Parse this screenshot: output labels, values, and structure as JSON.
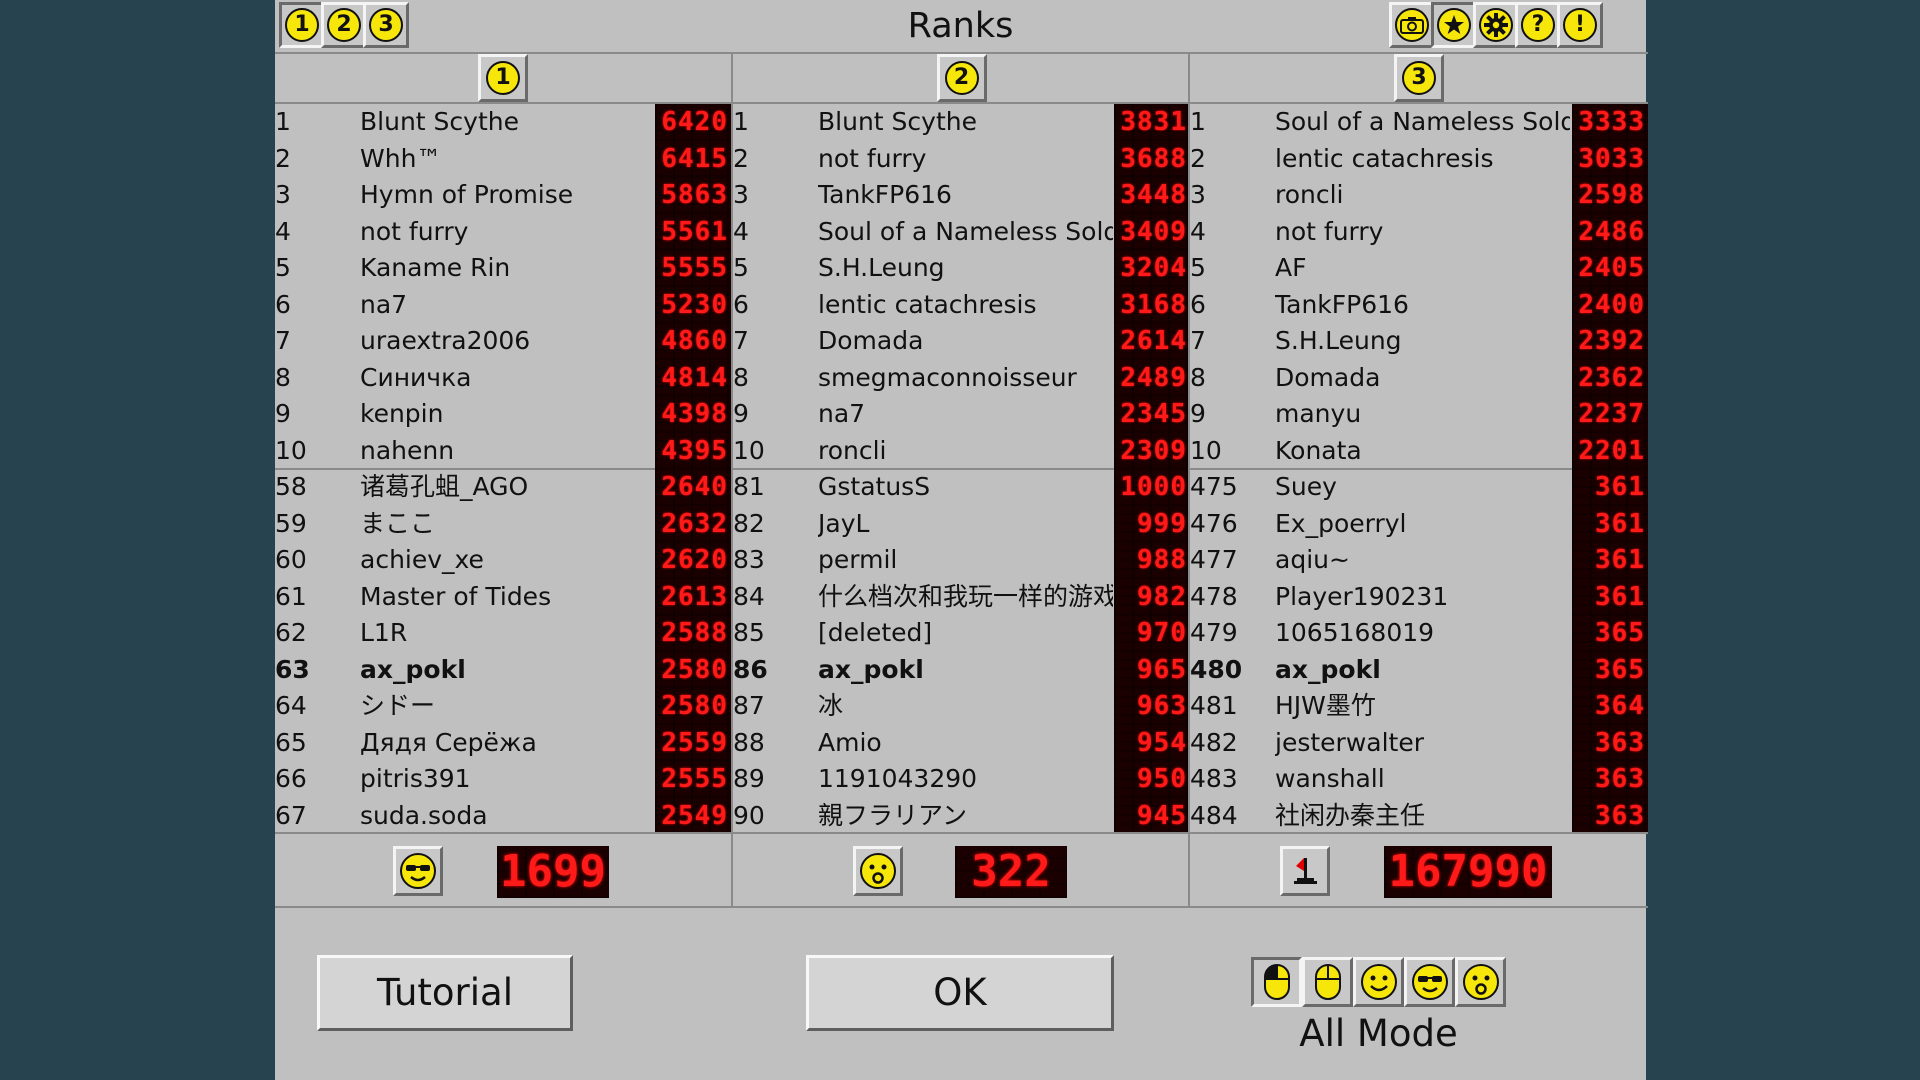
{
  "title": "Ranks",
  "colors": {
    "led_red": "#ff1a1a",
    "coin_yellow": "#f6e60a",
    "panel_gray": "#c0c0c0",
    "desktop": "#27434f"
  },
  "toolbar_left": [
    {
      "label": "1",
      "icon": "number-1-icon",
      "active": true
    },
    {
      "label": "2",
      "icon": "number-2-icon",
      "active": false
    },
    {
      "label": "3",
      "icon": "number-3-icon",
      "active": false
    }
  ],
  "toolbar_right": [
    {
      "icon": "camera-icon"
    },
    {
      "icon": "star-icon",
      "active": true
    },
    {
      "icon": "gear-icon"
    },
    {
      "icon": "help-icon",
      "label": "?"
    },
    {
      "icon": "exclamation-icon",
      "label": "!"
    }
  ],
  "columns": [
    {
      "header": "1",
      "top": [
        {
          "rank": "1",
          "name": "Blunt Scythe",
          "score": "6420"
        },
        {
          "rank": "2",
          "name": "Whh™",
          "score": "6415"
        },
        {
          "rank": "3",
          "name": "Hymn of Promise",
          "score": "5863"
        },
        {
          "rank": "4",
          "name": "not furry",
          "score": "5561"
        },
        {
          "rank": "5",
          "name": "Kaname Rin",
          "score": "5555"
        },
        {
          "rank": "6",
          "name": "na7",
          "score": "5230"
        },
        {
          "rank": "7",
          "name": "uraextra2006",
          "score": "4860"
        },
        {
          "rank": "8",
          "name": "Синичка",
          "score": "4814"
        },
        {
          "rank": "9",
          "name": "kenpin",
          "score": "4398"
        },
        {
          "rank": "10",
          "name": "nahenn",
          "score": "4395"
        }
      ],
      "near": [
        {
          "rank": "58",
          "name": "诸葛孔蛆_AGO",
          "score": "2640"
        },
        {
          "rank": "59",
          "name": "まここ",
          "score": "2632"
        },
        {
          "rank": "60",
          "name": "achiev_xe",
          "score": "2620"
        },
        {
          "rank": "61",
          "name": "Master of Tides",
          "score": "2613"
        },
        {
          "rank": "62",
          "name": "L1R",
          "score": "2588"
        },
        {
          "rank": "63",
          "name": "ax_pokl",
          "score": "2580",
          "me": true
        },
        {
          "rank": "64",
          "name": "シドー",
          "score": "2580"
        },
        {
          "rank": "65",
          "name": "Дядя Серёжа",
          "score": "2559"
        },
        {
          "rank": "66",
          "name": "pitris391",
          "score": "2555"
        },
        {
          "rank": "67",
          "name": "suda.soda",
          "score": "2549"
        }
      ],
      "footer": {
        "icon": "sunglasses-face-icon",
        "value": "1699"
      }
    },
    {
      "header": "2",
      "top": [
        {
          "rank": "1",
          "name": "Blunt Scythe",
          "score": "3831"
        },
        {
          "rank": "2",
          "name": "not furry",
          "score": "3688"
        },
        {
          "rank": "3",
          "name": "TankFP616",
          "score": "3448"
        },
        {
          "rank": "4",
          "name": "Soul of a Nameless Soldier",
          "score": "3409"
        },
        {
          "rank": "5",
          "name": "S.H.Leung",
          "score": "3204"
        },
        {
          "rank": "6",
          "name": "lentic catachresis",
          "score": "3168"
        },
        {
          "rank": "7",
          "name": "Domada",
          "score": "2614"
        },
        {
          "rank": "8",
          "name": "smegmaconnoisseur",
          "score": "2489"
        },
        {
          "rank": "9",
          "name": "na7",
          "score": "2345"
        },
        {
          "rank": "10",
          "name": "roncli",
          "score": "2309"
        }
      ],
      "near": [
        {
          "rank": "81",
          "name": "GstatusS",
          "score": "1000"
        },
        {
          "rank": "82",
          "name": "JayL",
          "score": "999"
        },
        {
          "rank": "83",
          "name": "permil",
          "score": "988"
        },
        {
          "rank": "84",
          "name": "什么档次和我玩一样的游戏",
          "score": "982"
        },
        {
          "rank": "85",
          "name": "[deleted]",
          "score": "970"
        },
        {
          "rank": "86",
          "name": "ax_pokl",
          "score": "965",
          "me": true
        },
        {
          "rank": "87",
          "name": "冰",
          "score": "963"
        },
        {
          "rank": "88",
          "name": "Amio",
          "score": "954"
        },
        {
          "rank": "89",
          "name": "1191043290",
          "score": "950"
        },
        {
          "rank": "90",
          "name": "親フラリアン",
          "score": "945"
        }
      ],
      "footer": {
        "icon": "surprised-face-icon",
        "value": "322"
      }
    },
    {
      "header": "3",
      "top": [
        {
          "rank": "1",
          "name": "Soul of a Nameless Soldier",
          "score": "3333"
        },
        {
          "rank": "2",
          "name": "lentic catachresis",
          "score": "3033"
        },
        {
          "rank": "3",
          "name": "roncli",
          "score": "2598"
        },
        {
          "rank": "4",
          "name": "not furry",
          "score": "2486"
        },
        {
          "rank": "5",
          "name": "AF",
          "score": "2405"
        },
        {
          "rank": "6",
          "name": "TankFP616",
          "score": "2400"
        },
        {
          "rank": "7",
          "name": "S.H.Leung",
          "score": "2392"
        },
        {
          "rank": "8",
          "name": "Domada",
          "score": "2362"
        },
        {
          "rank": "9",
          "name": "manyu",
          "score": "2237"
        },
        {
          "rank": "10",
          "name": "Konata",
          "score": "2201"
        }
      ],
      "near": [
        {
          "rank": "475",
          "name": "Suey",
          "score": "361"
        },
        {
          "rank": "476",
          "name": "Ex_poerryl",
          "score": "361"
        },
        {
          "rank": "477",
          "name": "aqiu~",
          "score": "361"
        },
        {
          "rank": "478",
          "name": "Player190231",
          "score": "361"
        },
        {
          "rank": "479",
          "name": "1065168019",
          "score": "365"
        },
        {
          "rank": "480",
          "name": "ax_pokl",
          "score": "365",
          "me": true
        },
        {
          "rank": "481",
          "name": "HJW墨竹",
          "score": "364"
        },
        {
          "rank": "482",
          "name": "jesterwalter",
          "score": "363"
        },
        {
          "rank": "483",
          "name": "wanshall",
          "score": "363"
        },
        {
          "rank": "484",
          "name": "社闲办秦主任",
          "score": "363"
        }
      ],
      "footer": {
        "icon": "flag-icon",
        "value": "167990"
      }
    }
  ],
  "buttons": {
    "tutorial": "Tutorial",
    "ok": "OK"
  },
  "mode": {
    "label": "All Mode",
    "icons": [
      "left-click-mouse-icon",
      "mouse-icon",
      "smiley-face-icon",
      "sunglasses-face-icon",
      "surprised-face-icon"
    ]
  }
}
